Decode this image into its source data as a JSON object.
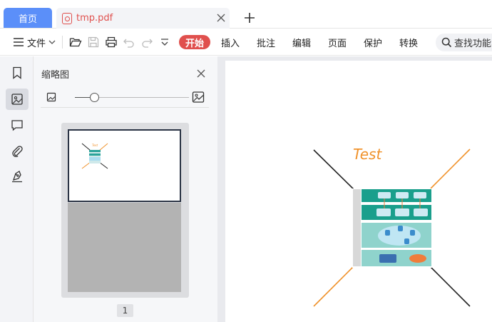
{
  "tabs": {
    "home_label": "首页",
    "file_label": "tmp.pdf"
  },
  "toolbar": {
    "file_menu_label": "文件",
    "start_label": "开始",
    "menu_items": [
      "插入",
      "批注",
      "编辑",
      "页面",
      "保护",
      "转换"
    ],
    "search_placeholder": "查找功能、"
  },
  "sidebar": {
    "rail_icons": [
      "bookmark-icon",
      "thumbnail-icon",
      "comment-icon",
      "attachment-icon",
      "signature-icon"
    ],
    "active_item": "thumbnail-icon"
  },
  "panel": {
    "title": "缩略图",
    "zoom_level": 0.17,
    "page_label": "1"
  },
  "document": {
    "annotation_text": "Test"
  },
  "colors": {
    "accent_blue": "#5b8ff9",
    "accent_red": "#e0504d",
    "annotation_orange": "#f0922b"
  }
}
